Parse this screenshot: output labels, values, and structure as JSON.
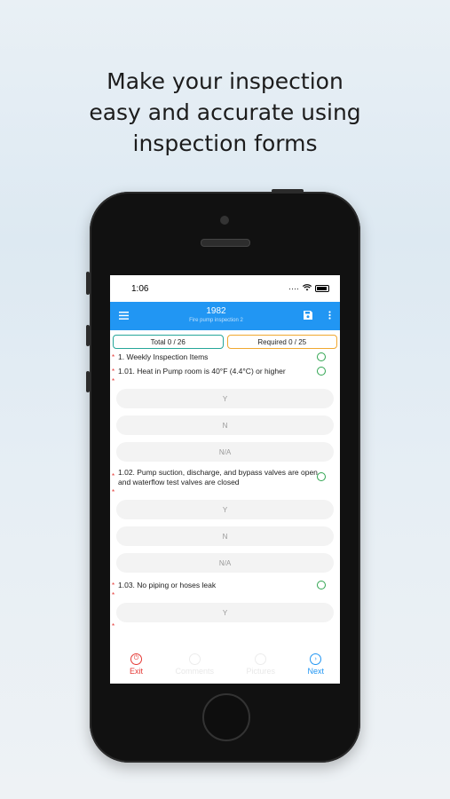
{
  "headline": [
    "Make your inspection",
    "easy and accurate using",
    "inspection forms"
  ],
  "status": {
    "time": "1:06",
    "signal": "....",
    "wifi": "wifi"
  },
  "appbar": {
    "title": "1982",
    "subtitle": "Fire pump inspection 2"
  },
  "counters": {
    "total": "Total  0 / 26",
    "required": "Required  0 / 25"
  },
  "questions": {
    "q1": "1. Weekly Inspection Items",
    "q101": "1.01. Heat in Pump room is 40°F (4.4°C) or higher",
    "q102": "1.02. Pump suction, discharge, and bypass valves are open and waterflow test valves are closed",
    "q103": "1.03. No piping or hoses leak"
  },
  "answers": {
    "y": "Y",
    "n": "N",
    "na": "N/A"
  },
  "bottombar": {
    "exit": "Exit",
    "next": "Next",
    "mid1": "Comments",
    "mid2": "Pictures"
  },
  "colors": {
    "primary": "#2196f3",
    "required": "#e53935",
    "ok": "#2ea44f",
    "total_border": "#26a69a",
    "req_border": "#f0a830"
  }
}
